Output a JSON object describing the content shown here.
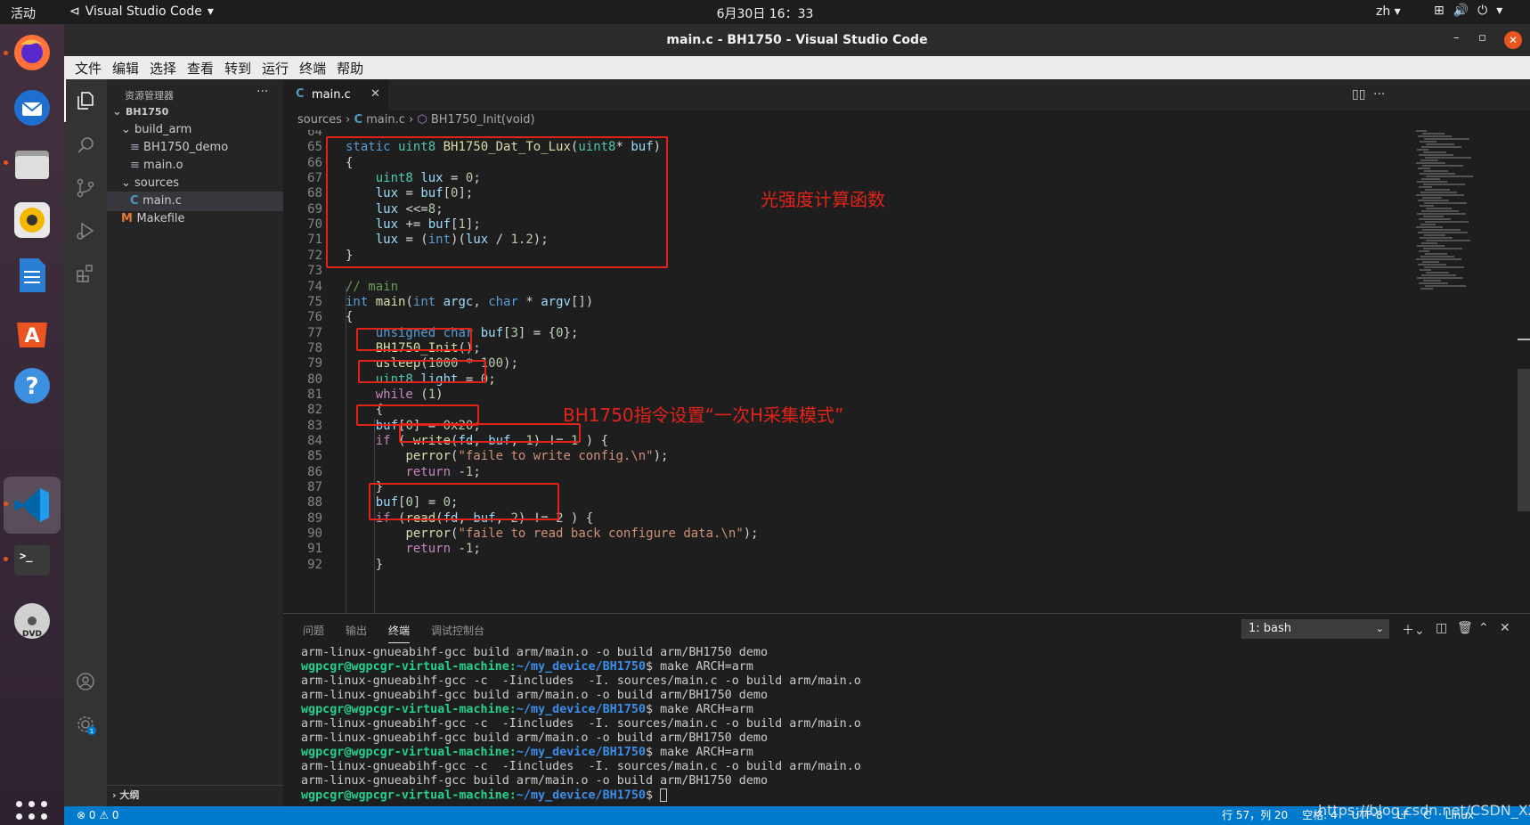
{
  "topbar": {
    "activities": "活动",
    "app_name": "Visual Studio Code",
    "clock": "6月30日  16：33",
    "lang": "zh"
  },
  "window": {
    "title": "main.c - BH1750 - Visual Studio Code"
  },
  "menubar": [
    "文件",
    "编辑",
    "选择",
    "查看",
    "转到",
    "运行",
    "终端",
    "帮助"
  ],
  "sidebar": {
    "header": "资源管理器",
    "tree": [
      {
        "label": "BH1750",
        "indent": 0,
        "kind": "root"
      },
      {
        "label": "build_arm",
        "indent": 1,
        "kind": "folder"
      },
      {
        "label": "BH1750_demo",
        "indent": 2,
        "kind": "file"
      },
      {
        "label": "main.o",
        "indent": 2,
        "kind": "file"
      },
      {
        "label": "sources",
        "indent": 1,
        "kind": "folder"
      },
      {
        "label": "main.c",
        "indent": 2,
        "kind": "cfile",
        "selected": true
      },
      {
        "label": "Makefile",
        "indent": 1,
        "kind": "make"
      }
    ],
    "outline": "大纲"
  },
  "tab": {
    "icon": "C",
    "label": "main.c"
  },
  "breadcrumb": {
    "folder": "sources",
    "file": "main.c",
    "symbol": "BH1750_Init(void)"
  },
  "code_lines": [
    {
      "n": "64",
      "t": ""
    },
    {
      "n": "65",
      "t": "static uint8 BH1750_Dat_To_Lux(uint8* buf)"
    },
    {
      "n": "66",
      "t": "{"
    },
    {
      "n": "67",
      "t": "    uint8 lux = 0;"
    },
    {
      "n": "68",
      "t": "    lux = buf[0];"
    },
    {
      "n": "69",
      "t": "    lux <<=8;"
    },
    {
      "n": "70",
      "t": "    lux += buf[1];"
    },
    {
      "n": "71",
      "t": "    lux = (int)(lux / 1.2);"
    },
    {
      "n": "72",
      "t": "}"
    },
    {
      "n": "73",
      "t": ""
    },
    {
      "n": "74",
      "t": "// main"
    },
    {
      "n": "75",
      "t": "int main(int argc, char * argv[])"
    },
    {
      "n": "76",
      "t": "{"
    },
    {
      "n": "77",
      "t": "    unsigned char buf[3] = {0};"
    },
    {
      "n": "78",
      "t": "    BH1750_Init();"
    },
    {
      "n": "79",
      "t": "    usleep(1000 * 100);"
    },
    {
      "n": "80",
      "t": "    uint8 light = 0;"
    },
    {
      "n": "81",
      "t": "    while (1)"
    },
    {
      "n": "82",
      "t": "    {"
    },
    {
      "n": "83",
      "t": "    buf[0] = 0x20;"
    },
    {
      "n": "84",
      "t": "    if ( write(fd, buf, 1) != 1 ) {"
    },
    {
      "n": "85",
      "t": "        perror(\"faile to write config.\\n\");"
    },
    {
      "n": "86",
      "t": "        return -1;"
    },
    {
      "n": "87",
      "t": "    }"
    },
    {
      "n": "88",
      "t": "    buf[0] = 0;"
    },
    {
      "n": "89",
      "t": "    if (read(fd, buf, 2) != 2 ) {"
    },
    {
      "n": "90",
      "t": "        perror(\"faile to read back configure data.\\n\");"
    },
    {
      "n": "91",
      "t": "        return -1;"
    },
    {
      "n": "92",
      "t": "    }"
    }
  ],
  "annotations": {
    "lux_func": "光强度计算函数",
    "mode_cmd": "BH1750指令设置“一次H采集模式”"
  },
  "panel": {
    "tabs": [
      "问题",
      "输出",
      "终端",
      "调试控制台"
    ],
    "active_tab": "终端",
    "terminal_select": "1: bash"
  },
  "terminal_lines": [
    {
      "kind": "out",
      "text": "arm-linux-gnueabihf-gcc build arm/main.o -o build arm/BH1750 demo"
    },
    {
      "kind": "prompt",
      "user": "wgpcgr@wgpcgr-virtual-machine",
      "path": "~/my_device/BH1750",
      "cmd": "$ make ARCH=arm"
    },
    {
      "kind": "out",
      "text": "arm-linux-gnueabihf-gcc -c  -Iincludes  -I. sources/main.c -o build arm/main.o"
    },
    {
      "kind": "out",
      "text": "arm-linux-gnueabihf-gcc build arm/main.o -o build arm/BH1750 demo"
    },
    {
      "kind": "prompt",
      "user": "wgpcgr@wgpcgr-virtual-machine",
      "path": "~/my_device/BH1750",
      "cmd": "$ make ARCH=arm"
    },
    {
      "kind": "out",
      "text": "arm-linux-gnueabihf-gcc -c  -Iincludes  -I. sources/main.c -o build arm/main.o"
    },
    {
      "kind": "out",
      "text": "arm-linux-gnueabihf-gcc build arm/main.o -o build arm/BH1750 demo"
    },
    {
      "kind": "prompt",
      "user": "wgpcgr@wgpcgr-virtual-machine",
      "path": "~/my_device/BH1750",
      "cmd": "$ make ARCH=arm"
    },
    {
      "kind": "out",
      "text": "arm-linux-gnueabihf-gcc -c  -Iincludes  -I. sources/main.c -o build arm/main.o"
    },
    {
      "kind": "out",
      "text": "arm-linux-gnueabihf-gcc build arm/main.o -o build arm/BH1750 demo"
    },
    {
      "kind": "prompt",
      "user": "wgpcgr@wgpcgr-virtual-machine",
      "path": "~/my_device/BH1750",
      "cmd": "$ "
    }
  ],
  "statusbar": {
    "problems": "⊗ 0 ⚠ 0",
    "position": "行 57，列 20",
    "spaces": "空格: 4",
    "encoding": "UTF-8",
    "eol": "LF",
    "lang": "C",
    "os": "Linux"
  },
  "watermark": "https://blog.csdn.net/CSDN_XZ",
  "colors": {
    "statusbar": "#007acc",
    "annotation_red": "#e2231a",
    "ubuntu_orange": "#e95420"
  }
}
